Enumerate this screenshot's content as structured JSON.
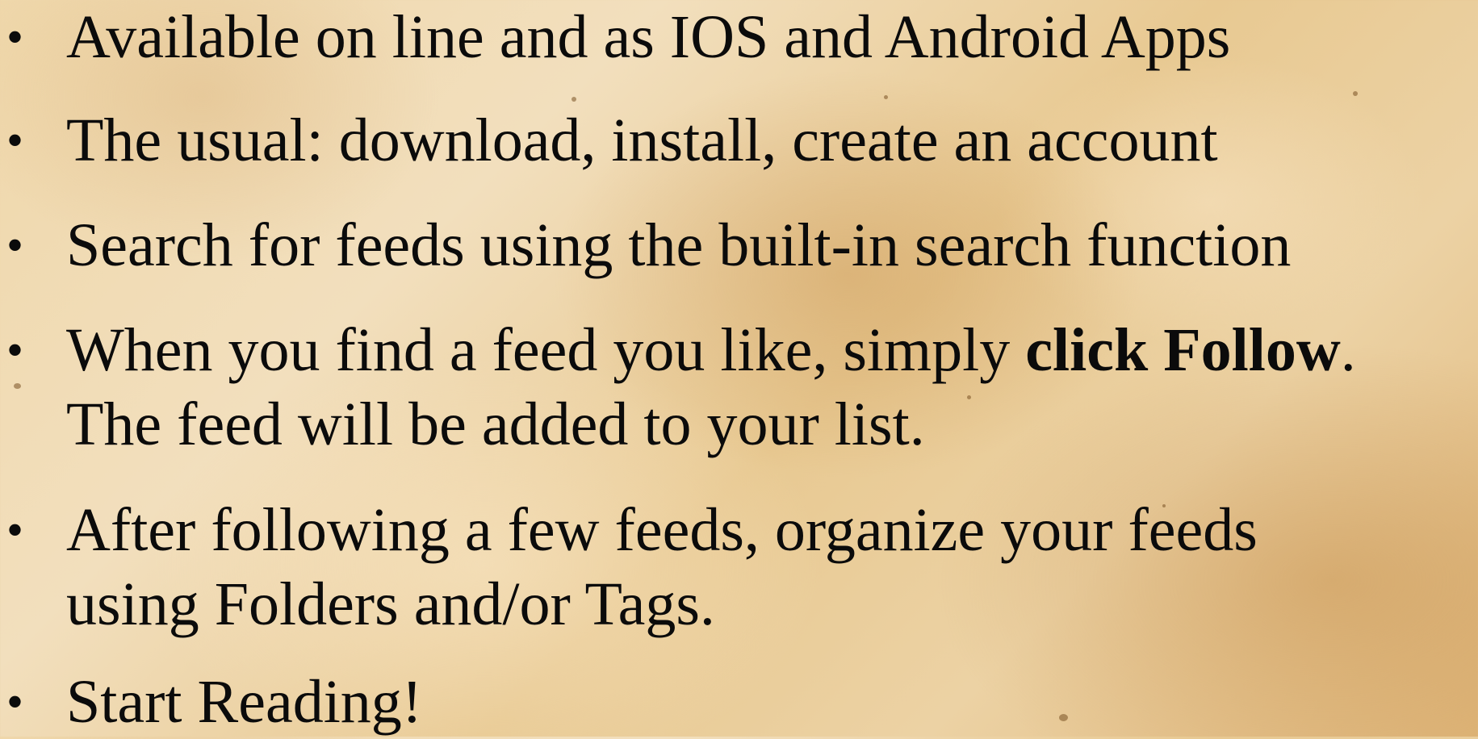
{
  "slide": {
    "bullets": [
      {
        "lines": [
          "Available on line and as IOS and Android Apps"
        ]
      },
      {
        "lines": [
          "The usual: download, install, create an account"
        ]
      },
      {
        "lines": [
          "Search for feeds using the built-in search function"
        ]
      },
      {
        "line1_pre": "When you find a feed you like, simply ",
        "line1_bold": "click Follow",
        "line1_post": ".",
        "line2": "The feed will be added to your list."
      },
      {
        "lines": [
          "After following a few feeds, organize your feeds",
          "using Folders and/or Tags."
        ]
      },
      {
        "lines": [
          "Start Reading!"
        ]
      }
    ],
    "bullet_glyph": "•"
  }
}
